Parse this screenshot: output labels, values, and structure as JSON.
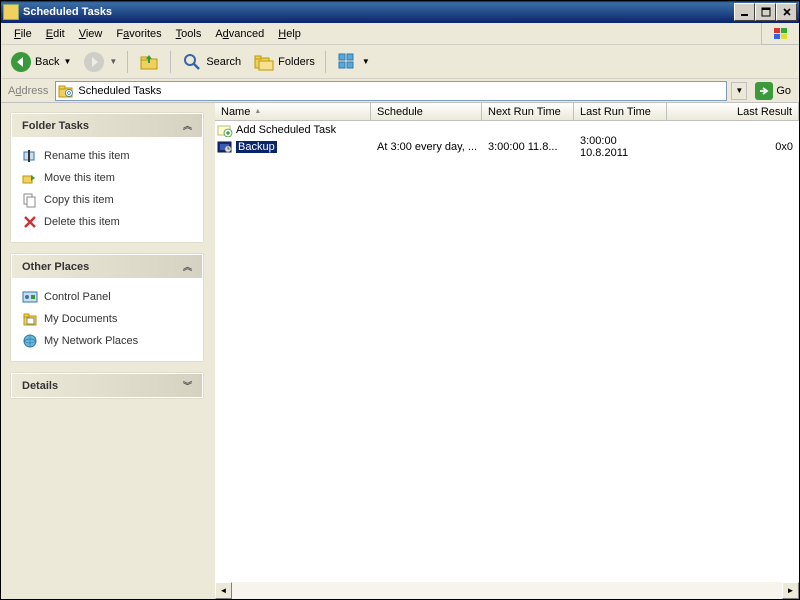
{
  "window": {
    "title": "Scheduled Tasks"
  },
  "menu": {
    "file": "File",
    "edit": "Edit",
    "view": "View",
    "favorites": "Favorites",
    "tools": "Tools",
    "advanced": "Advanced",
    "help": "Help"
  },
  "toolbar": {
    "back": "Back",
    "search": "Search",
    "folders": "Folders"
  },
  "addressbar": {
    "label": "Address",
    "value": "Scheduled Tasks",
    "go": "Go"
  },
  "left": {
    "folder_tasks": {
      "title": "Folder Tasks",
      "rename": "Rename this item",
      "move": "Move this item",
      "copy": "Copy this item",
      "delete": "Delete this item"
    },
    "other_places": {
      "title": "Other Places",
      "control": "Control Panel",
      "docs": "My Documents",
      "network": "My Network Places"
    },
    "details": {
      "title": "Details"
    }
  },
  "columns": {
    "name": "Name",
    "schedule": "Schedule",
    "next": "Next Run Time",
    "last": "Last Run Time",
    "result": "Last Result"
  },
  "items": [
    {
      "name": "Add Scheduled Task",
      "schedule": "",
      "next": "",
      "last": "",
      "result": ""
    },
    {
      "name": "Backup",
      "schedule": "At 3:00 every day, ...",
      "next": "3:00:00  11.8...",
      "last": "3:00:00  10.8.2011",
      "result": "0x0"
    }
  ]
}
